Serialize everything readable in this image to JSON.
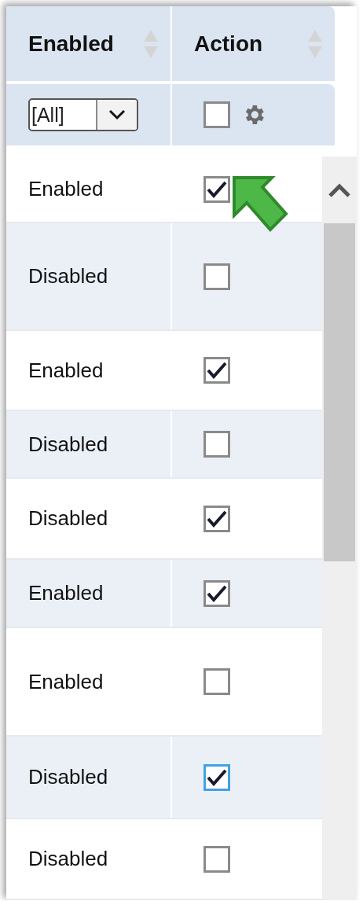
{
  "columns": [
    {
      "label": "Enabled"
    },
    {
      "label": "Action"
    }
  ],
  "filter": {
    "value": "[All]",
    "select_all_checked": false
  },
  "rows": [
    {
      "status": "Enabled",
      "checked": true,
      "focused": false
    },
    {
      "status": "Disabled",
      "checked": false,
      "focused": false
    },
    {
      "status": "Enabled",
      "checked": true,
      "focused": false
    },
    {
      "status": "Disabled",
      "checked": false,
      "focused": false
    },
    {
      "status": "Disabled",
      "checked": true,
      "focused": false
    },
    {
      "status": "Enabled",
      "checked": true,
      "focused": false
    },
    {
      "status": "Enabled",
      "checked": false,
      "focused": false
    },
    {
      "status": "Disabled",
      "checked": true,
      "focused": true
    },
    {
      "status": "Disabled",
      "checked": false,
      "focused": false
    }
  ]
}
